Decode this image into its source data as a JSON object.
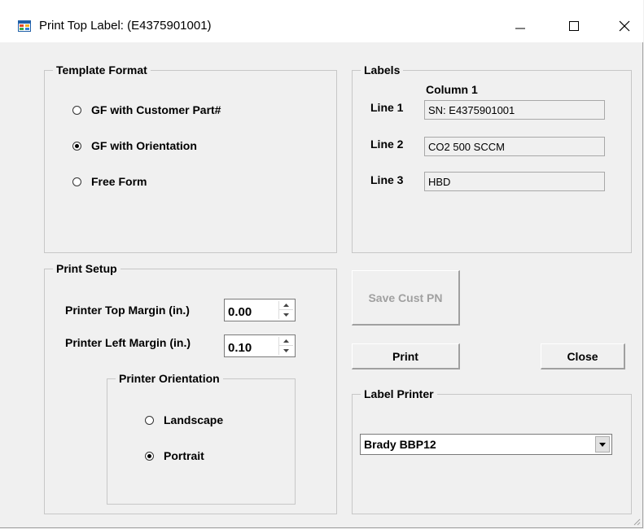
{
  "window": {
    "title": "Print Top Label: (E4375901001)"
  },
  "template_format": {
    "legend": "Template Format",
    "options": [
      {
        "label": "GF with Customer Part#",
        "checked": false
      },
      {
        "label": "GF with Orientation",
        "checked": true
      },
      {
        "label": "Free Form",
        "checked": false
      }
    ]
  },
  "labels": {
    "legend": "Labels",
    "column_header": "Column 1",
    "lines": [
      {
        "label": "Line 1",
        "value": "SN: E4375901001"
      },
      {
        "label": "Line 2",
        "value": "CO2 500 SCCM"
      },
      {
        "label": "Line 3",
        "value": "HBD"
      }
    ]
  },
  "print_setup": {
    "legend": "Print Setup",
    "top_margin_label": "Printer Top Margin (in.)",
    "top_margin_value": "0.00",
    "left_margin_label": "Printer Left Margin (in.)",
    "left_margin_value": "0.10",
    "orientation": {
      "legend": "Printer Orientation",
      "options": [
        {
          "label": "Landscape",
          "checked": false
        },
        {
          "label": "Portrait",
          "checked": true
        }
      ]
    }
  },
  "buttons": {
    "save_cust_pn": "Save Cust PN",
    "print": "Print",
    "close": "Close"
  },
  "label_printer": {
    "legend": "Label Printer",
    "selected": "Brady BBP12"
  },
  "icons": {
    "app": "app-window-icon",
    "minimize": "minimize-icon",
    "maximize": "maximize-icon",
    "close": "close-icon"
  }
}
